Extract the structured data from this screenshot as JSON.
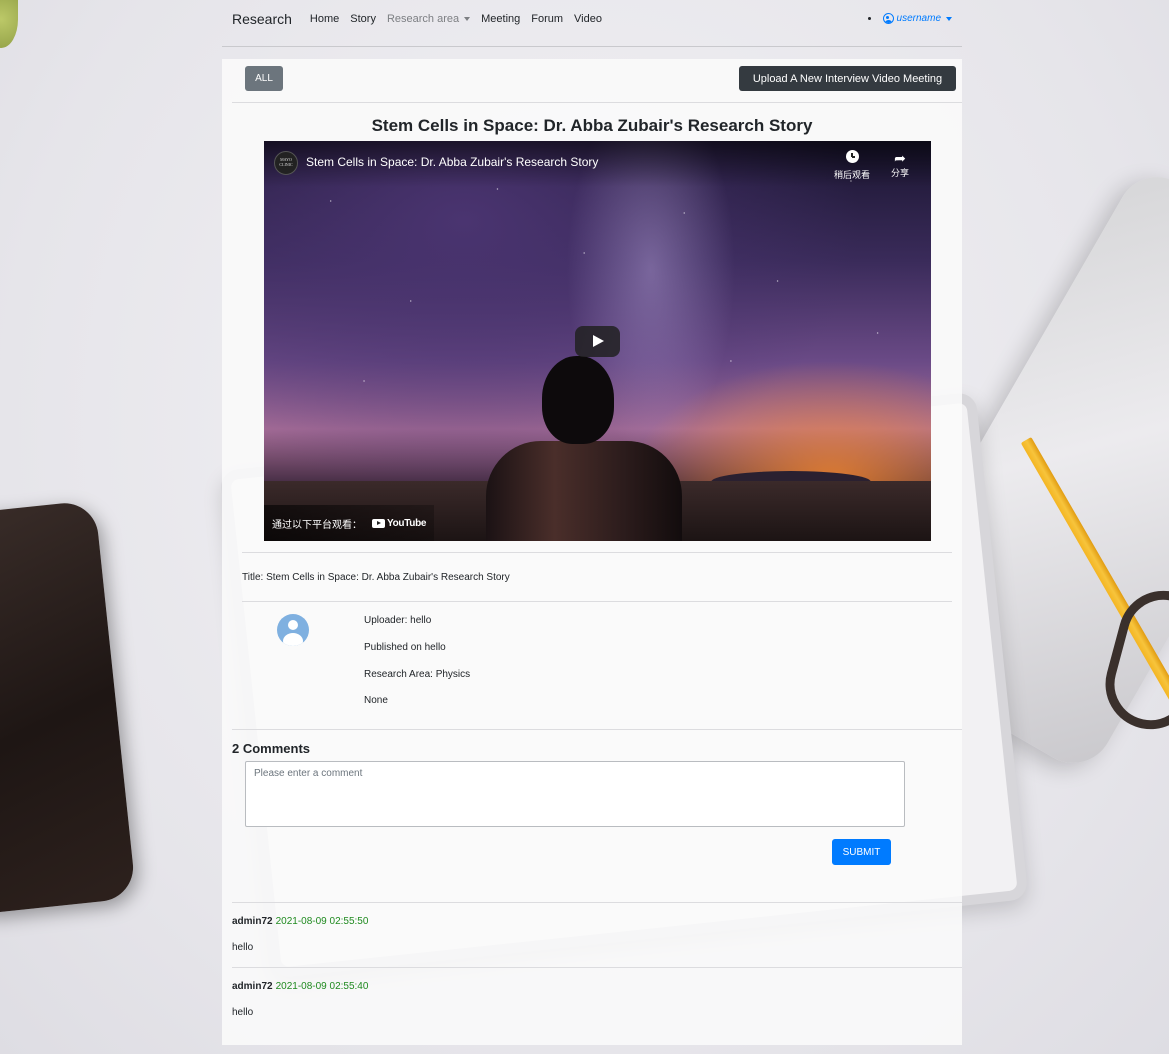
{
  "nav": {
    "brand": "Research",
    "links": [
      "Home",
      "Story"
    ],
    "research_area": "Research area",
    "links_after": [
      "Meeting",
      "Forum",
      "Video"
    ],
    "username": "username"
  },
  "toolbar": {
    "all_label": "ALL",
    "upload_label": "Upload A New Interview Video Meeting"
  },
  "video": {
    "heading": "Stem Cells in Space: Dr. Abba Zubair's Research Story",
    "player_title": "Stem Cells in Space: Dr. Abba Zubair's Research Story",
    "badge_text": "MAYO CLINIC",
    "watch_later": "稍后观看",
    "share": "分享",
    "watch_on": "通过以下平台观看：",
    "youtube": "YouTube"
  },
  "details": {
    "title_line": "Title: Stem Cells in Space: Dr. Abba Zubair's Research Story",
    "uploader": "Uploader: hello",
    "published": "Published on hello",
    "research_area": "Research Area: Physics",
    "extra": "None"
  },
  "comments": {
    "heading": "2 Comments",
    "placeholder": "Please enter a comment",
    "submit_label": "SUBMIT",
    "items": [
      {
        "author": "admin72",
        "time": "2021-08-09 02:55:50",
        "text": "hello"
      },
      {
        "author": "admin72",
        "time": "2021-08-09 02:55:40",
        "text": "hello"
      }
    ]
  },
  "colors": {
    "accent": "#007bff",
    "dark_button": "#343a40",
    "secondary_button": "#6c757d",
    "timestamp": "#1f8a1f"
  }
}
